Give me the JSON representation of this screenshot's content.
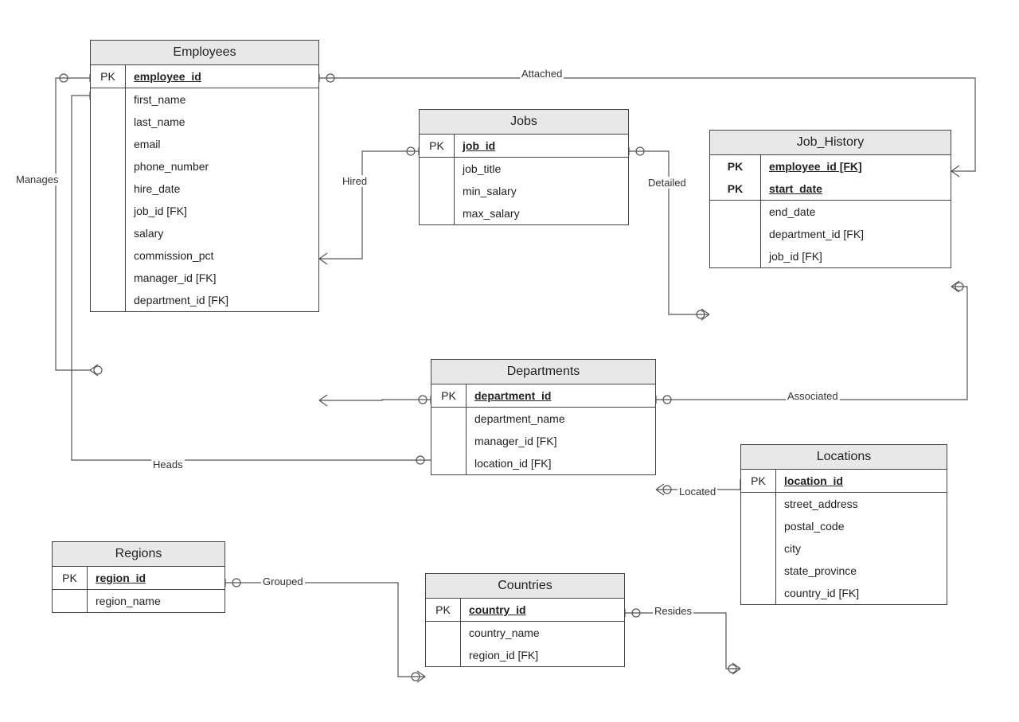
{
  "entities": {
    "employees": {
      "title": "Employees",
      "pk_label": "PK",
      "pk": "employee_id",
      "attrs": [
        "first_name",
        "last_name",
        "email",
        "phone_number",
        "hire_date",
        "job_id [FK]",
        "salary",
        "commission_pct",
        "manager_id [FK]",
        "department_id [FK]"
      ]
    },
    "jobs": {
      "title": "Jobs",
      "pk_label": "PK",
      "pk": "job_id",
      "attrs": [
        "job_title",
        "min_salary",
        "max_salary"
      ]
    },
    "job_history": {
      "title": "Job_History",
      "pk_label": "PK",
      "pks": [
        "employee_id [FK]",
        "start_date"
      ],
      "attrs": [
        "end_date",
        "department_id [FK]",
        "job_id [FK]"
      ]
    },
    "departments": {
      "title": "Departments",
      "pk_label": "PK",
      "pk": "department_id",
      "attrs": [
        "department_name",
        "manager_id [FK]",
        "location_id [FK]"
      ]
    },
    "regions": {
      "title": "Regions",
      "pk_label": "PK",
      "pk": "region_id",
      "attrs": [
        "region_name"
      ]
    },
    "countries": {
      "title": "Countries",
      "pk_label": "PK",
      "pk": "country_id",
      "attrs": [
        "country_name",
        "region_id [FK]"
      ]
    },
    "locations": {
      "title": "Locations",
      "pk_label": "PK",
      "pk": "location_id",
      "attrs": [
        "street_address",
        "postal_code",
        "city",
        "state_province",
        "country_id [FK]"
      ]
    }
  },
  "relationships": {
    "manages": "Manages",
    "attached": "Attached",
    "hired": "Hired",
    "detailed": "Detailed",
    "associated": "Associated",
    "heads": "Heads",
    "located": "Located",
    "grouped": "Grouped",
    "resides": "Resides"
  }
}
